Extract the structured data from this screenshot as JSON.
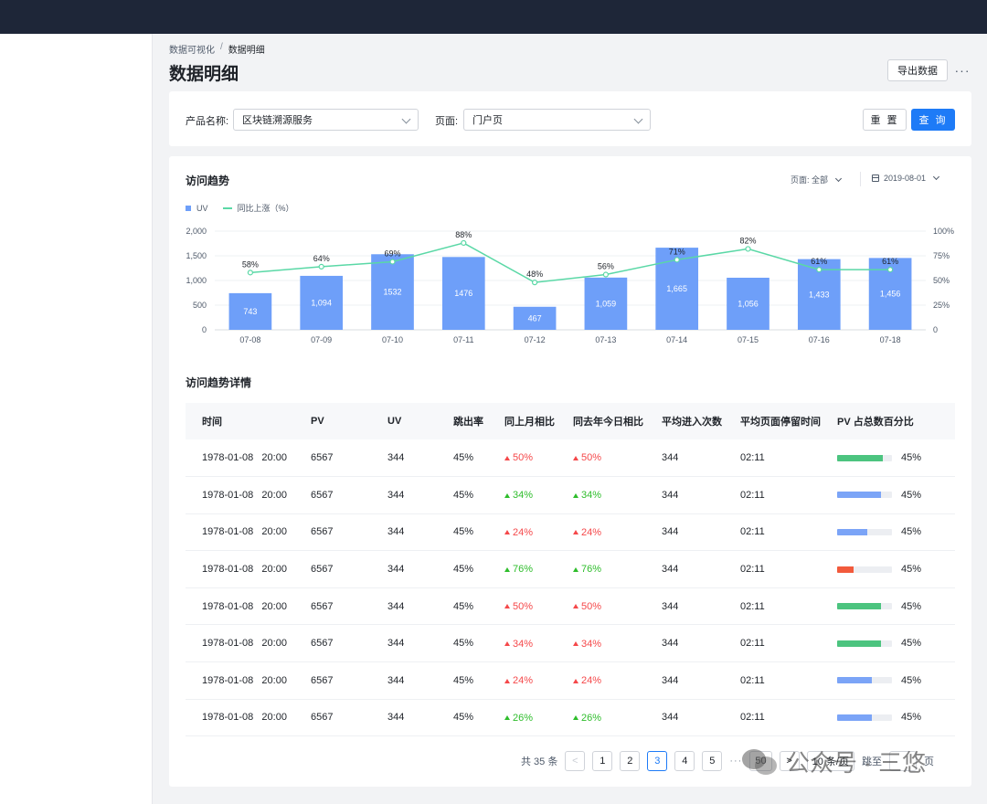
{
  "breadcrumb": {
    "parent": "数据可视化",
    "separator": "/",
    "current": "数据明细"
  },
  "page": {
    "title": "数据明细",
    "export_label": "导出数据",
    "more_label": "···"
  },
  "filters": {
    "product_label": "产品名称:",
    "product_value": "区块链溯源服务",
    "page_label": "页面:",
    "page_value": "门户页",
    "reset_label": "重 置",
    "query_label": "查 询"
  },
  "trend": {
    "title": "访问趋势",
    "page_filter": "页面: 全部",
    "date_filter": "2019-08-01",
    "legend_uv": "UV",
    "legend_rate": "同比上涨（%）"
  },
  "chart_data": {
    "type": "bar",
    "categories": [
      "07-08",
      "07-09",
      "07-10",
      "07-11",
      "07-12",
      "07-13",
      "07-14",
      "07-15",
      "07-16",
      "07-18"
    ],
    "series": [
      {
        "name": "UV",
        "type": "bar",
        "values": [
          743,
          1094,
          1532,
          1476,
          467,
          1059,
          1665,
          1056,
          1433,
          1456
        ],
        "labels": [
          "743",
          "1,094",
          "1532",
          "1476",
          "467",
          "1,059",
          "1,665",
          "1,056",
          "1,433",
          "1,456"
        ],
        "axis": "left",
        "color": "#6e9ff9"
      },
      {
        "name": "同比上涨（%）",
        "type": "line",
        "values": [
          58,
          64,
          69,
          88,
          48,
          56,
          71,
          82,
          61,
          61
        ],
        "axis": "right",
        "color": "#5ad8a6"
      }
    ],
    "y_left": {
      "ylim": [
        0,
        2000
      ],
      "ticks": [
        "0",
        "500",
        "1,000",
        "1,500",
        "2,000"
      ]
    },
    "y_right": {
      "ylim": [
        0,
        100
      ],
      "ticks": [
        "0",
        "25%",
        "50%",
        "75%",
        "100%"
      ]
    },
    "legend_position": "top-left",
    "grid": true
  },
  "detail": {
    "title": "访问趋势详情",
    "columns": [
      "时间",
      "PV",
      "UV",
      "跳出率",
      "同上月相比",
      "同去年今日相比",
      "平均进入次数",
      "平均页面停留时间",
      "PV 占总数百分比"
    ],
    "rows": [
      {
        "time": "1978-01-08   20:00",
        "pv": "6567",
        "uv": "344",
        "bounce": "45%",
        "mom": "50%",
        "mom_dir": "red",
        "yoy": "50%",
        "yoy_dir": "red",
        "avg_visits": "344",
        "avg_stay": "02:11",
        "pct": "45%",
        "bar_fill": 0.83,
        "bar_color": "#4cc47f"
      },
      {
        "time": "1978-01-08   20:00",
        "pv": "6567",
        "uv": "344",
        "bounce": "45%",
        "mom": "34%",
        "mom_dir": "green",
        "yoy": "34%",
        "yoy_dir": "green",
        "avg_visits": "344",
        "avg_stay": "02:11",
        "pct": "45%",
        "bar_fill": 0.8,
        "bar_color": "#7ba4f7"
      },
      {
        "time": "1978-01-08   20:00",
        "pv": "6567",
        "uv": "344",
        "bounce": "45%",
        "mom": "24%",
        "mom_dir": "red",
        "yoy": "24%",
        "yoy_dir": "red",
        "avg_visits": "344",
        "avg_stay": "02:11",
        "pct": "45%",
        "bar_fill": 0.55,
        "bar_color": "#7ba4f7"
      },
      {
        "time": "1978-01-08   20:00",
        "pv": "6567",
        "uv": "344",
        "bounce": "45%",
        "mom": "76%",
        "mom_dir": "green",
        "yoy": "76%",
        "yoy_dir": "green",
        "avg_visits": "344",
        "avg_stay": "02:11",
        "pct": "45%",
        "bar_fill": 0.3,
        "bar_color": "#f25a3c"
      },
      {
        "time": "1978-01-08   20:00",
        "pv": "6567",
        "uv": "344",
        "bounce": "45%",
        "mom": "50%",
        "mom_dir": "red",
        "yoy": "50%",
        "yoy_dir": "red",
        "avg_visits": "344",
        "avg_stay": "02:11",
        "pct": "45%",
        "bar_fill": 0.8,
        "bar_color": "#4cc47f"
      },
      {
        "time": "1978-01-08   20:00",
        "pv": "6567",
        "uv": "344",
        "bounce": "45%",
        "mom": "34%",
        "mom_dir": "red",
        "yoy": "34%",
        "yoy_dir": "red",
        "avg_visits": "344",
        "avg_stay": "02:11",
        "pct": "45%",
        "bar_fill": 0.8,
        "bar_color": "#4cc47f"
      },
      {
        "time": "1978-01-08   20:00",
        "pv": "6567",
        "uv": "344",
        "bounce": "45%",
        "mom": "24%",
        "mom_dir": "red",
        "yoy": "24%",
        "yoy_dir": "red",
        "avg_visits": "344",
        "avg_stay": "02:11",
        "pct": "45%",
        "bar_fill": 0.63,
        "bar_color": "#7ba4f7"
      },
      {
        "time": "1978-01-08   20:00",
        "pv": "6567",
        "uv": "344",
        "bounce": "45%",
        "mom": "26%",
        "mom_dir": "green",
        "yoy": "26%",
        "yoy_dir": "green",
        "avg_visits": "344",
        "avg_stay": "02:11",
        "pct": "45%",
        "bar_fill": 0.63,
        "bar_color": "#7ba4f7"
      }
    ]
  },
  "pagination": {
    "total": "共 35 条",
    "prev": "<",
    "pages": [
      "1",
      "2",
      "3",
      "4",
      "5"
    ],
    "current": "3",
    "ellipsis": "···",
    "last": "50",
    "next": ">",
    "page_size": "10 条/页",
    "jump_label": "跳至",
    "jump_suffix": "页"
  },
  "watermark": {
    "text": "公众号 · 三悠"
  },
  "icons": {
    "more": "more-icon",
    "chevron": "chevron-down-icon",
    "calendar": "calendar-icon",
    "watermark": "wechat-icon"
  }
}
